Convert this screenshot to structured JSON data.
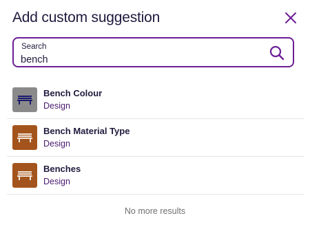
{
  "dialog": {
    "title": "Add custom suggestion",
    "close_icon": "close-icon"
  },
  "search": {
    "label": "Search",
    "value": "bench",
    "icon": "search-icon"
  },
  "results": [
    {
      "name": "Bench Colour",
      "category": "Design",
      "thumb_color": "#8a8a8a",
      "thumb_icon": "bench-icon"
    },
    {
      "name": "Bench Material Type",
      "category": "Design",
      "thumb_color": "#a3541c",
      "thumb_icon": "bench-icon"
    },
    {
      "name": "Benches",
      "category": "Design",
      "thumb_color": "#a3541c",
      "thumb_icon": "bench-icon"
    }
  ],
  "footer": {
    "text": "No more results"
  },
  "colors": {
    "accent": "#6b1d95",
    "text": "#1f1a3d"
  }
}
